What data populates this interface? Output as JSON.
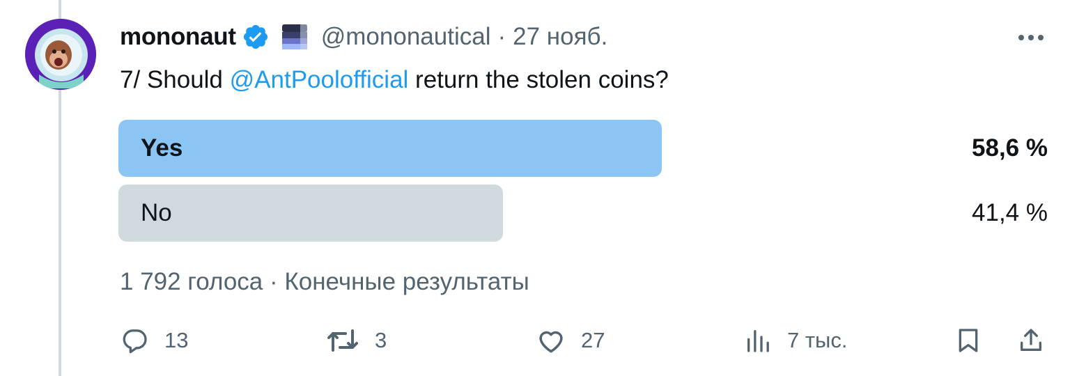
{
  "tweet": {
    "display_name": "mononaut",
    "handle": "@mononautical",
    "separator": "·",
    "date": "27 нояб.",
    "text_before": "7/ Should ",
    "mention": "@AntPoolofficial",
    "text_after": " return the stolen coins?"
  },
  "poll": {
    "options": [
      {
        "label": "Yes",
        "percent_text": "58,6 %",
        "percent": 58.6,
        "winner": true
      },
      {
        "label": "No",
        "percent_text": "41,4 %",
        "percent": 41.4,
        "winner": false
      }
    ],
    "votes": "1 792 голоса",
    "separator": "·",
    "status": "Конечные результаты"
  },
  "actions": {
    "replies": "13",
    "reposts": "3",
    "likes": "27",
    "views": "7 тыс."
  },
  "colors": {
    "accent": "#1d9bf0",
    "poll_winner": "#8ac5f3",
    "poll_other": "#cfd9de",
    "muted_text": "#536471",
    "avatar_bg": "#5b21b6"
  },
  "icons": [
    "avatar",
    "verified-badge-icon",
    "flag-icon",
    "more-icon",
    "reply-icon",
    "repost-icon",
    "like-icon",
    "views-icon",
    "bookmark-icon",
    "share-icon"
  ]
}
